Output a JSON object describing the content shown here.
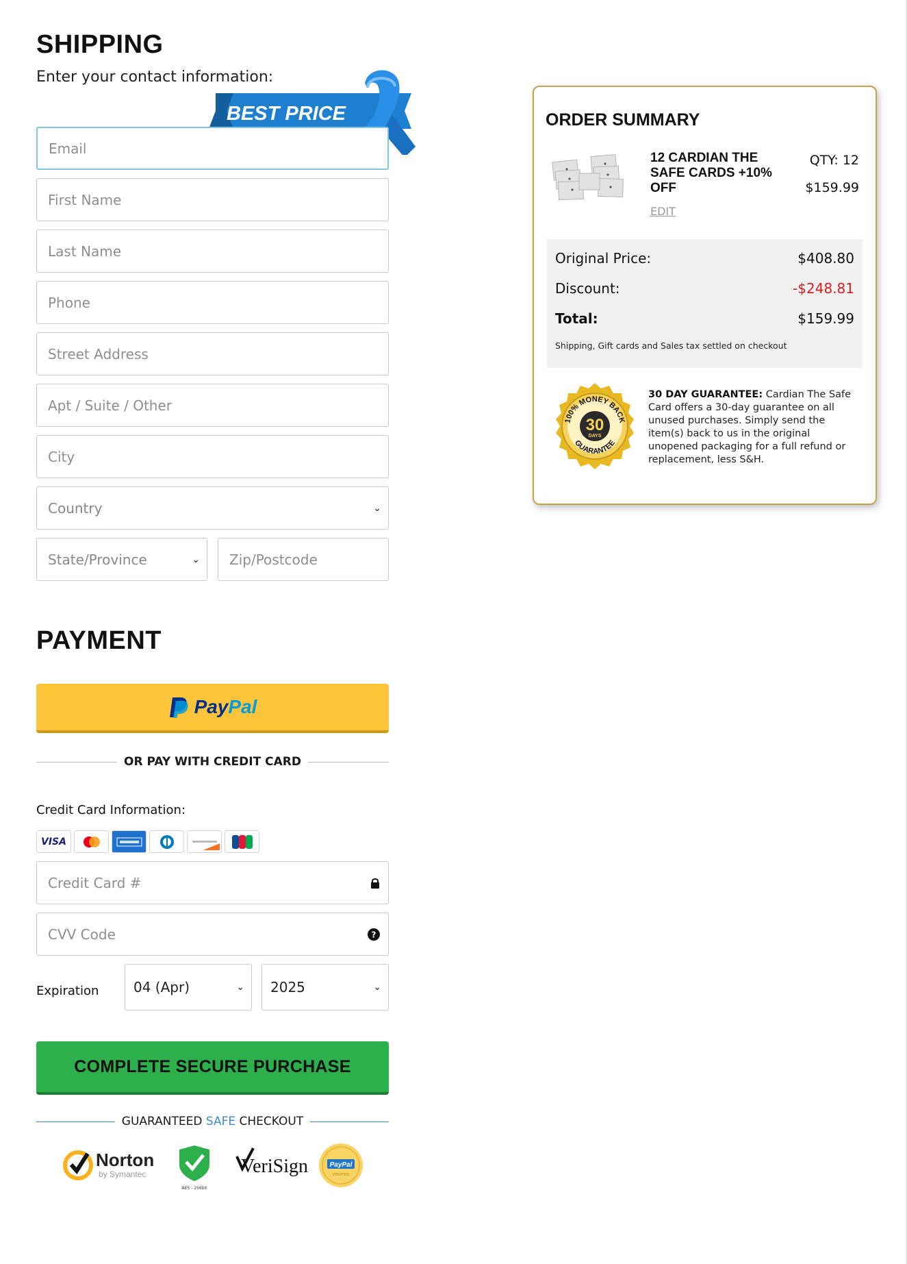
{
  "shipping": {
    "title": "SHIPPING",
    "subtitle": "Enter your contact information:",
    "ribbon_label": "BEST PRICE",
    "fields": {
      "email": "Email",
      "first_name": "First Name",
      "last_name": "Last Name",
      "phone": "Phone",
      "street": "Street Address",
      "apt": "Apt / Suite / Other",
      "city": "City",
      "country": "Country",
      "state": "State/Province",
      "zip": "Zip/Postcode"
    }
  },
  "payment": {
    "title": "PAYMENT",
    "paypal_label_a": "Pay",
    "paypal_label_b": "Pal",
    "or_divider": "OR PAY WITH CREDIT CARD",
    "cc_info_label": "Credit Card Information:",
    "card_brands": [
      "VISA",
      "MC",
      "AMEX",
      "DINERS",
      "DISCOVER",
      "JCB"
    ],
    "card_number_placeholder": "Credit Card #",
    "cvv_placeholder": "CVV Code",
    "expiration_label": "Expiration",
    "exp_month": "04 (Apr)",
    "exp_year": "2025",
    "submit_label": "COMPLETE SECURE PURCHASE",
    "safe_checkout": {
      "pre": "GUARANTEED ",
      "mid": "SAFE",
      "post": " CHECKOUT"
    },
    "badges": {
      "norton": "Norton",
      "norton_sub": "by Symantec",
      "aes": "AES - 256bit",
      "verisign": "VeriSign",
      "paypal_verified": "PayPal",
      "paypal_verified_sub": "VERIFIED"
    }
  },
  "order_summary": {
    "title": "ORDER SUMMARY",
    "product_name": "12 CARDIAN THE SAFE CARDS +10% OFF",
    "qty": "QTY: 12",
    "price": "$159.99",
    "edit_label": "EDIT",
    "original_price_label": "Original Price:",
    "original_price": "$408.80",
    "discount_label": "Discount:",
    "discount": "-$248.81",
    "total_label": "Total:",
    "total": "$159.99",
    "note": "Shipping, Gift cards and Sales tax settled on checkout",
    "seal_top": "100% MONEY BACK",
    "seal_number": "30",
    "seal_days": "DAYS",
    "seal_bottom": "GUARANTEE",
    "guarantee_title": "30 DAY GUARANTEE:",
    "guarantee_text": " Cardian The Safe Card offers a 30-day guarantee on all unused purchases. Simply send the item(s) back to us in the original unopened packaging for a full refund or replacement, less S&H."
  },
  "colors": {
    "paypal_yellow": "#ffc439",
    "buy_green": "#2db04b",
    "accent_blue": "#3a8bd0",
    "summary_gold": "#c9a24a",
    "discount_red": "#d71d1d"
  }
}
